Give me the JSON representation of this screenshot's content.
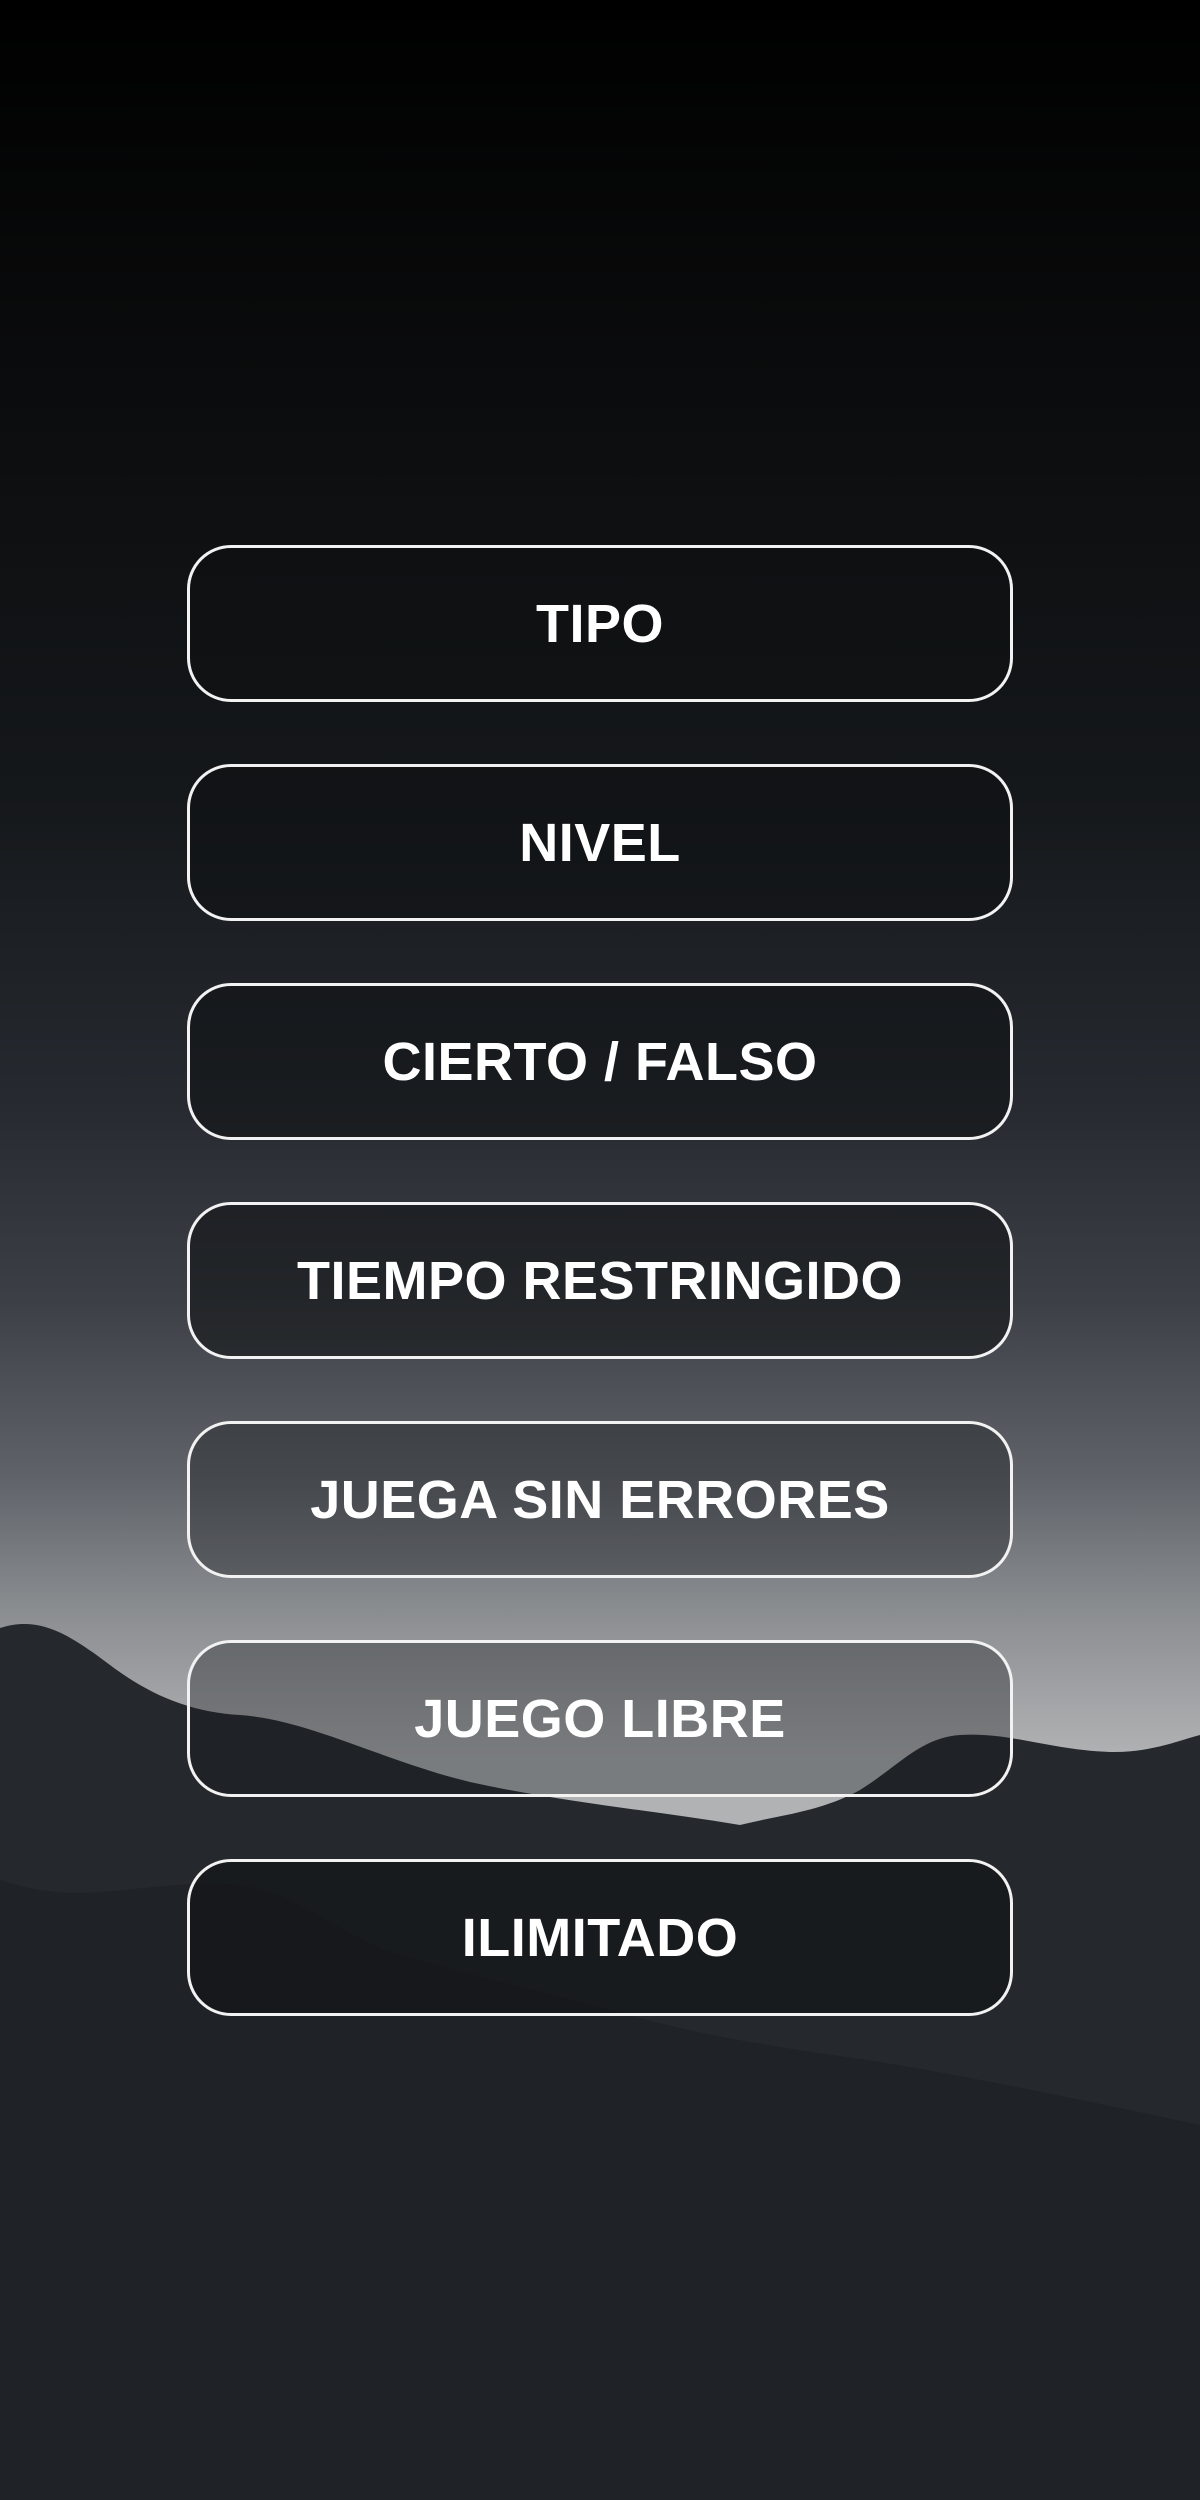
{
  "menu": {
    "buttons": [
      {
        "label": "TIPO"
      },
      {
        "label": "NIVEL"
      },
      {
        "label": "CIERTO / FALSO"
      },
      {
        "label": "TIEMPO RESTRINGIDO"
      },
      {
        "label": "JUEGA SIN ERRORES"
      },
      {
        "label": "JUEGO LIBRE"
      },
      {
        "label": "ILIMITADO"
      }
    ]
  },
  "colors": {
    "button_border": "#f2f2f2",
    "button_text": "#ffffff",
    "mountain_back": "#23262b",
    "mountain_front": "#1f2226"
  }
}
